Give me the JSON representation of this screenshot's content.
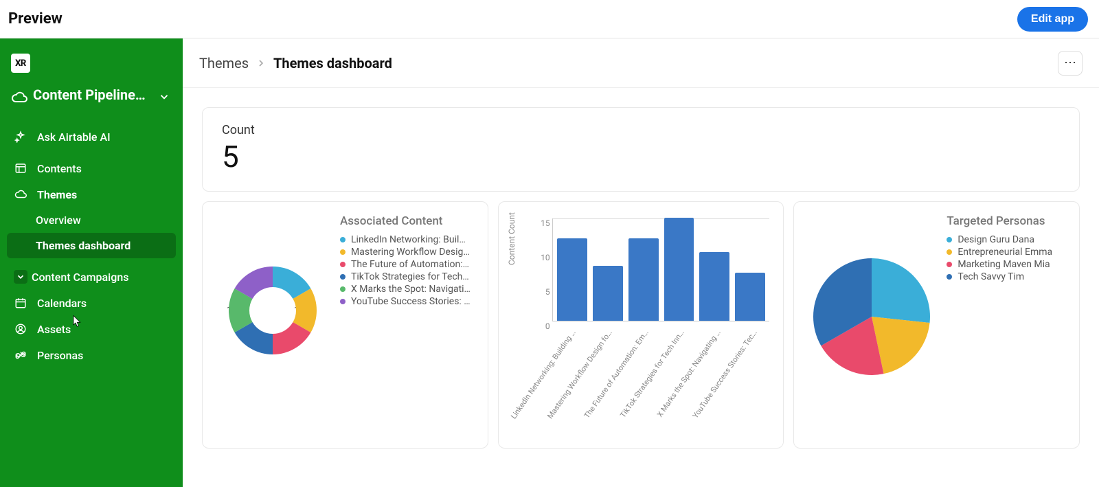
{
  "topbar": {
    "title": "Preview",
    "edit_label": "Edit app"
  },
  "sidebar": {
    "logo_text": "XR",
    "workspace_title": "Content Pipeline…",
    "items": [
      {
        "key": "ask-ai",
        "label": "Ask Airtable AI",
        "icon": "sparkle-icon"
      },
      {
        "key": "contents",
        "label": "Contents",
        "icon": "grid-icon"
      },
      {
        "key": "themes",
        "label": "Themes",
        "icon": "cloud-icon",
        "bold": true,
        "children": [
          {
            "key": "overview",
            "label": "Overview"
          },
          {
            "key": "themes-dashboard",
            "label": "Themes dashboard",
            "selected": true
          }
        ]
      },
      {
        "key": "content-campaigns",
        "label": "Content Campaigns",
        "icon": "chevron-down-icon",
        "caret_box": true
      },
      {
        "key": "calendars",
        "label": "Calendars",
        "icon": "calendar-icon"
      },
      {
        "key": "assets",
        "label": "Assets",
        "icon": "circle-user-icon"
      },
      {
        "key": "personas",
        "label": "Personas",
        "icon": "infinity-icon"
      }
    ]
  },
  "breadcrumb": {
    "items": [
      "Themes",
      "Themes dashboard"
    ]
  },
  "count_card": {
    "label": "Count",
    "value": "5"
  },
  "chart_data": [
    {
      "type": "pie",
      "donut": true,
      "title": "Associated Content",
      "categories": [
        "LinkedIn Networking: Buil…",
        "Mastering Workflow Desig…",
        "The Future of Automation:…",
        "TikTok Strategies for Tech…",
        "X Marks the Spot: Navigati…",
        "YouTube Success Stories: …"
      ],
      "values": [
        16.7,
        16.7,
        16.7,
        16.7,
        16.7,
        16.7
      ],
      "value_labels": [
        "16.7%",
        "16.7%",
        "16.7%",
        "16.7%",
        "16.7%",
        "16.7%"
      ],
      "colors": [
        "#3aaed8",
        "#f2b92b",
        "#e94a6b",
        "#2f6fb3",
        "#58b96b",
        "#8e60c8"
      ]
    },
    {
      "type": "bar",
      "title": "",
      "xlabel": "",
      "ylabel": "Content Count",
      "ylim": [
        0,
        15
      ],
      "yticks": [
        0,
        5,
        10,
        15
      ],
      "categories": [
        "LinkedIn Networking: Building …",
        "Mastering Workflow Design fo…",
        "The Future of Automation: Em…",
        "TikTok Strategies for Tech Inn…",
        "X Marks the Spot: Navigating …",
        "YouTube Success Stories: Tec…"
      ],
      "values": [
        12,
        8,
        12,
        15,
        10,
        7
      ],
      "colors": [
        "#3a78c6"
      ]
    },
    {
      "type": "pie",
      "donut": false,
      "title": "Targeted Personas",
      "categories": [
        "Design Guru Dana",
        "Entrepreneurial Emma",
        "Marketing Maven Mia",
        "Tech Savvy Tim"
      ],
      "values": [
        26.7,
        20.0,
        20.0,
        33.3
      ],
      "value_labels": [
        "26.7%",
        "20.0%",
        "20.0%",
        "33.3%"
      ],
      "colors": [
        "#3aaed8",
        "#f2b92b",
        "#e94a6b",
        "#2f6fb3"
      ]
    }
  ]
}
